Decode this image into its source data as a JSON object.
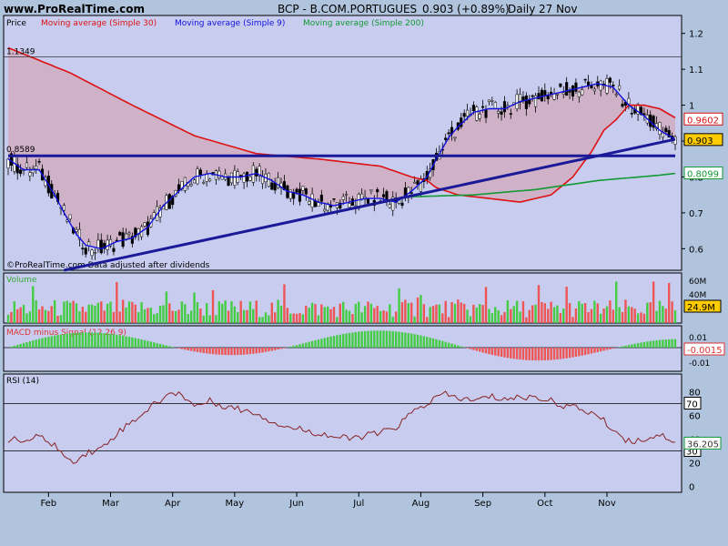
{
  "header": {
    "site": "www.ProRealTime.com",
    "symbol": "BCP - B.COM.PORTUGUES",
    "quote": "0.903 (+0.89%)",
    "period": "Daily",
    "date": "27 Nov"
  },
  "legend": {
    "price": "Price",
    "ma30": "Moving average (Simple 30)",
    "ma9": "Moving average (Simple 9)",
    "ma200": "Moving average (Simple 200)",
    "watermark": "©ProRealTime.com Data adjusted after dividends"
  },
  "colors": {
    "background": "#b0c4de",
    "plot_bg": "#c8cdf0",
    "ma30": "#dd1111",
    "ma9": "#1111dd",
    "ma200": "#119933",
    "trendline": "#1a1a99",
    "vol_up": "#44cc44",
    "vol_down": "#ee5555",
    "rsi_line": "#882222"
  },
  "chart_data": [
    {
      "type": "line",
      "panel": "price",
      "ylim": [
        0.54,
        1.25
      ],
      "y_ticks": [
        "1.2",
        "1.1",
        "1",
        "0.9",
        "0.8",
        "0.7",
        "0.6"
      ],
      "x_ticks": [
        "Feb",
        "Mar",
        "Apr",
        "May",
        "Jun",
        "Jul",
        "Aug",
        "Sep",
        "Oct",
        "Nov"
      ],
      "annotations": [
        "1.1349",
        "0.8589"
      ],
      "right_labels": [
        "0.9602",
        "0.903",
        "0.8099"
      ],
      "series": [
        {
          "name": "Moving average (Simple 30)",
          "x": [
            0,
            10,
            20,
            40,
            60,
            80,
            100,
            120,
            130,
            135,
            138,
            145,
            155,
            165,
            175,
            182,
            188,
            192,
            196,
            200,
            205,
            210,
            215
          ],
          "values": [
            1.16,
            1.125,
            1.09,
            1.0,
            0.915,
            0.865,
            0.85,
            0.83,
            0.8,
            0.79,
            0.77,
            0.75,
            0.74,
            0.73,
            0.75,
            0.8,
            0.87,
            0.93,
            0.96,
            1.0,
            1.0,
            0.99,
            0.965
          ]
        },
        {
          "name": "Moving average (Simple 9)",
          "x": [
            0,
            5,
            10,
            15,
            18,
            22,
            25,
            30,
            35,
            40,
            45,
            50,
            55,
            60,
            65,
            70,
            75,
            80,
            85,
            90,
            95,
            100,
            105,
            110,
            115,
            120,
            125,
            130,
            135,
            138,
            140,
            142,
            145,
            150,
            155,
            160,
            165,
            170,
            175,
            180,
            185,
            190,
            195,
            200,
            205,
            210,
            215
          ],
          "values": [
            0.85,
            0.82,
            0.82,
            0.75,
            0.7,
            0.64,
            0.61,
            0.6,
            0.62,
            0.63,
            0.66,
            0.72,
            0.76,
            0.8,
            0.81,
            0.8,
            0.8,
            0.81,
            0.79,
            0.76,
            0.75,
            0.73,
            0.72,
            0.73,
            0.74,
            0.74,
            0.73,
            0.76,
            0.8,
            0.85,
            0.88,
            0.91,
            0.94,
            0.98,
            0.99,
            0.99,
            1.01,
            1.02,
            1.03,
            1.04,
            1.05,
            1.06,
            1.05,
            1.0,
            0.97,
            0.93,
            0.905
          ]
        },
        {
          "name": "Moving average (Simple 200)",
          "x": [
            130,
            150,
            170,
            190,
            210,
            215
          ],
          "values": [
            0.745,
            0.75,
            0.765,
            0.79,
            0.805,
            0.81
          ]
        }
      ],
      "trendlines": [
        {
          "name": "support",
          "x": [
            18,
            215
          ],
          "values": [
            0.54,
            0.905
          ]
        },
        {
          "name": "horizontal",
          "x": [
            0,
            215
          ],
          "values": [
            0.8589,
            0.8589
          ]
        }
      ]
    },
    {
      "type": "bar",
      "panel": "volume",
      "title": "Volume",
      "y_ticks": [
        "60M",
        "40M",
        "20M"
      ],
      "last_value": "24.9M"
    },
    {
      "type": "bar",
      "panel": "macd",
      "title": "MACD minus Signal (12 26 9)",
      "y_ticks": [
        "0.01",
        "-0.01"
      ],
      "last_value": "-0.0015"
    },
    {
      "type": "line",
      "panel": "rsi",
      "title": "RSI (14)",
      "ylim": [
        -5,
        95
      ],
      "y_ticks": [
        "80",
        "60",
        "40",
        "20",
        "0"
      ],
      "reference_lines": [
        "70",
        "30"
      ],
      "last_value": "36.205",
      "x": [
        0,
        5,
        10,
        15,
        20,
        25,
        30,
        35,
        40,
        45,
        50,
        55,
        60,
        65,
        70,
        75,
        80,
        85,
        90,
        95,
        100,
        105,
        110,
        115,
        120,
        125,
        130,
        135,
        140,
        145,
        150,
        155,
        160,
        165,
        170,
        175,
        180,
        185,
        190,
        195,
        200,
        205,
        210,
        215
      ],
      "values": [
        40,
        38,
        42,
        35,
        20,
        28,
        32,
        45,
        55,
        65,
        75,
        80,
        68,
        72,
        68,
        65,
        62,
        55,
        50,
        48,
        45,
        42,
        40,
        43,
        45,
        50,
        62,
        70,
        78,
        75,
        72,
        76,
        74,
        75,
        76,
        72,
        68,
        65,
        60,
        48,
        38,
        40,
        44,
        38
      ]
    }
  ]
}
